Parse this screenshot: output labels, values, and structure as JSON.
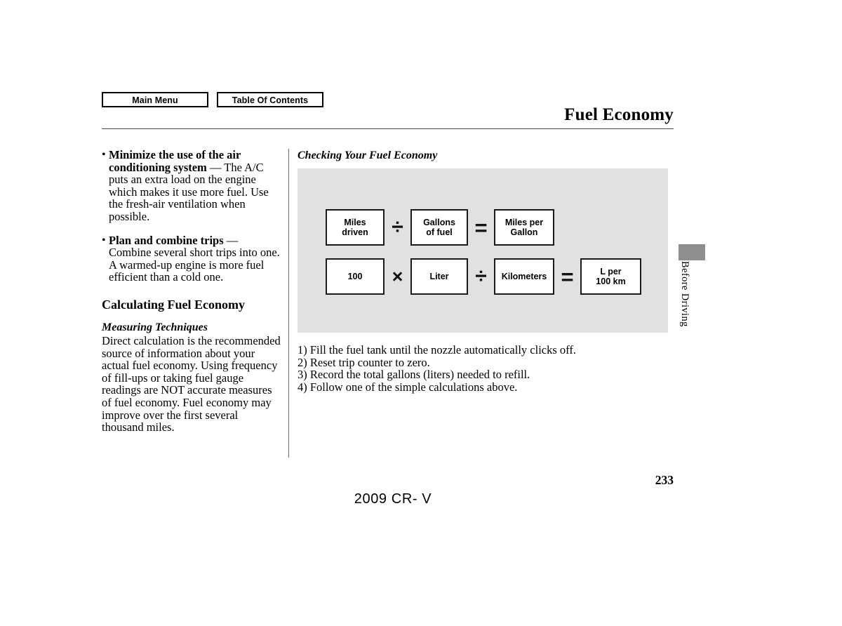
{
  "nav": {
    "main_menu": "Main Menu",
    "table_of_contents": "Table Of Contents"
  },
  "header": {
    "title": "Fuel Economy"
  },
  "left_column": {
    "bullets": [
      {
        "lead": "Minimize the use of the air conditioning system",
        "rest": " — The A/C puts an extra load on the engine which makes it use more fuel. Use the fresh-air ventilation when possible."
      },
      {
        "lead": "Plan and combine trips",
        "rest": " — Combine several short trips into one. A warmed-up engine is more fuel efficient than a cold one."
      }
    ],
    "section_heading": "Calculating Fuel Economy",
    "sub_heading": "Measuring Techniques",
    "body": "Direct calculation is the recommended source of information about your actual fuel economy. Using frequency of fill-ups or taking fuel gauge readings are NOT accurate measures of fuel economy. Fuel economy may improve over the first several thousand miles."
  },
  "right_column": {
    "diagram_caption": "Checking Your Fuel Economy",
    "formula_rows": [
      {
        "box1_line1": "Miles",
        "box1_line2": "driven",
        "op1": "÷",
        "box2_line1": "Gallons",
        "box2_line2": "of fuel",
        "op2": "=",
        "box3_line1": "Miles per",
        "box3_line2": "Gallon"
      },
      {
        "box1_line1": "100",
        "op1": "×",
        "box2_line1": "Liter",
        "op2": "÷",
        "box3_line1": "Kilometers",
        "op3": "=",
        "box4_line1": "L per",
        "box4_line2": "100 km"
      }
    ],
    "steps": [
      "1) Fill the fuel tank until the nozzle automatically clicks off.",
      "2) Reset trip counter to zero.",
      "3) Record the total gallons (liters) needed to refill.",
      "4) Follow one of the simple calculations above."
    ]
  },
  "side_tab": {
    "label": "Before Driving"
  },
  "footer": {
    "page_number": "233",
    "model": "2009  CR- V"
  },
  "colors": {
    "panel_gray": "#e1e1e3",
    "tab_gray": "#8e8e8e",
    "rule_gray": "#4a4a4a",
    "text_black": "#000000"
  }
}
